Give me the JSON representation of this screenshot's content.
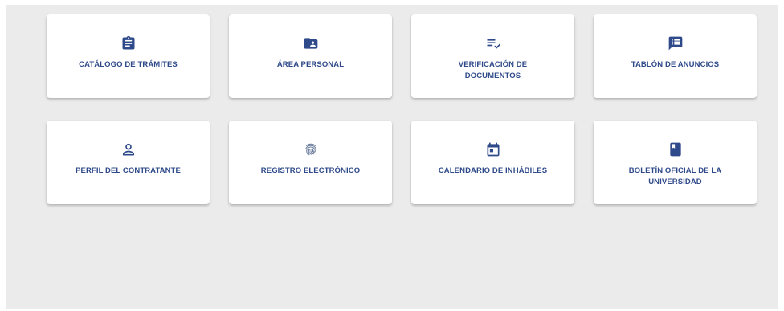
{
  "accent_color": "#2f4a8a",
  "background_color": "#ebebeb",
  "tiles": [
    {
      "label": "CATÁLOGO DE TRÁMITES",
      "icon": "clipboard-icon"
    },
    {
      "label": "ÁREA PERSONAL",
      "icon": "folder-account-icon"
    },
    {
      "label": "VERIFICACIÓN DE DOCUMENTOS",
      "icon": "list-check-icon"
    },
    {
      "label": "TABLÓN DE ANUNCIOS",
      "icon": "message-list-icon"
    },
    {
      "label": "PERFIL DEL CONTRATANTE",
      "icon": "person-outline-icon"
    },
    {
      "label": "REGISTRO ELECTRÓNICO",
      "icon": "fingerprint-icon"
    },
    {
      "label": "CALENDARIO DE INHÁBILES",
      "icon": "calendar-icon"
    },
    {
      "label": "BOLETÍN OFICIAL DE LA UNIVERSIDAD",
      "icon": "book-icon"
    }
  ]
}
